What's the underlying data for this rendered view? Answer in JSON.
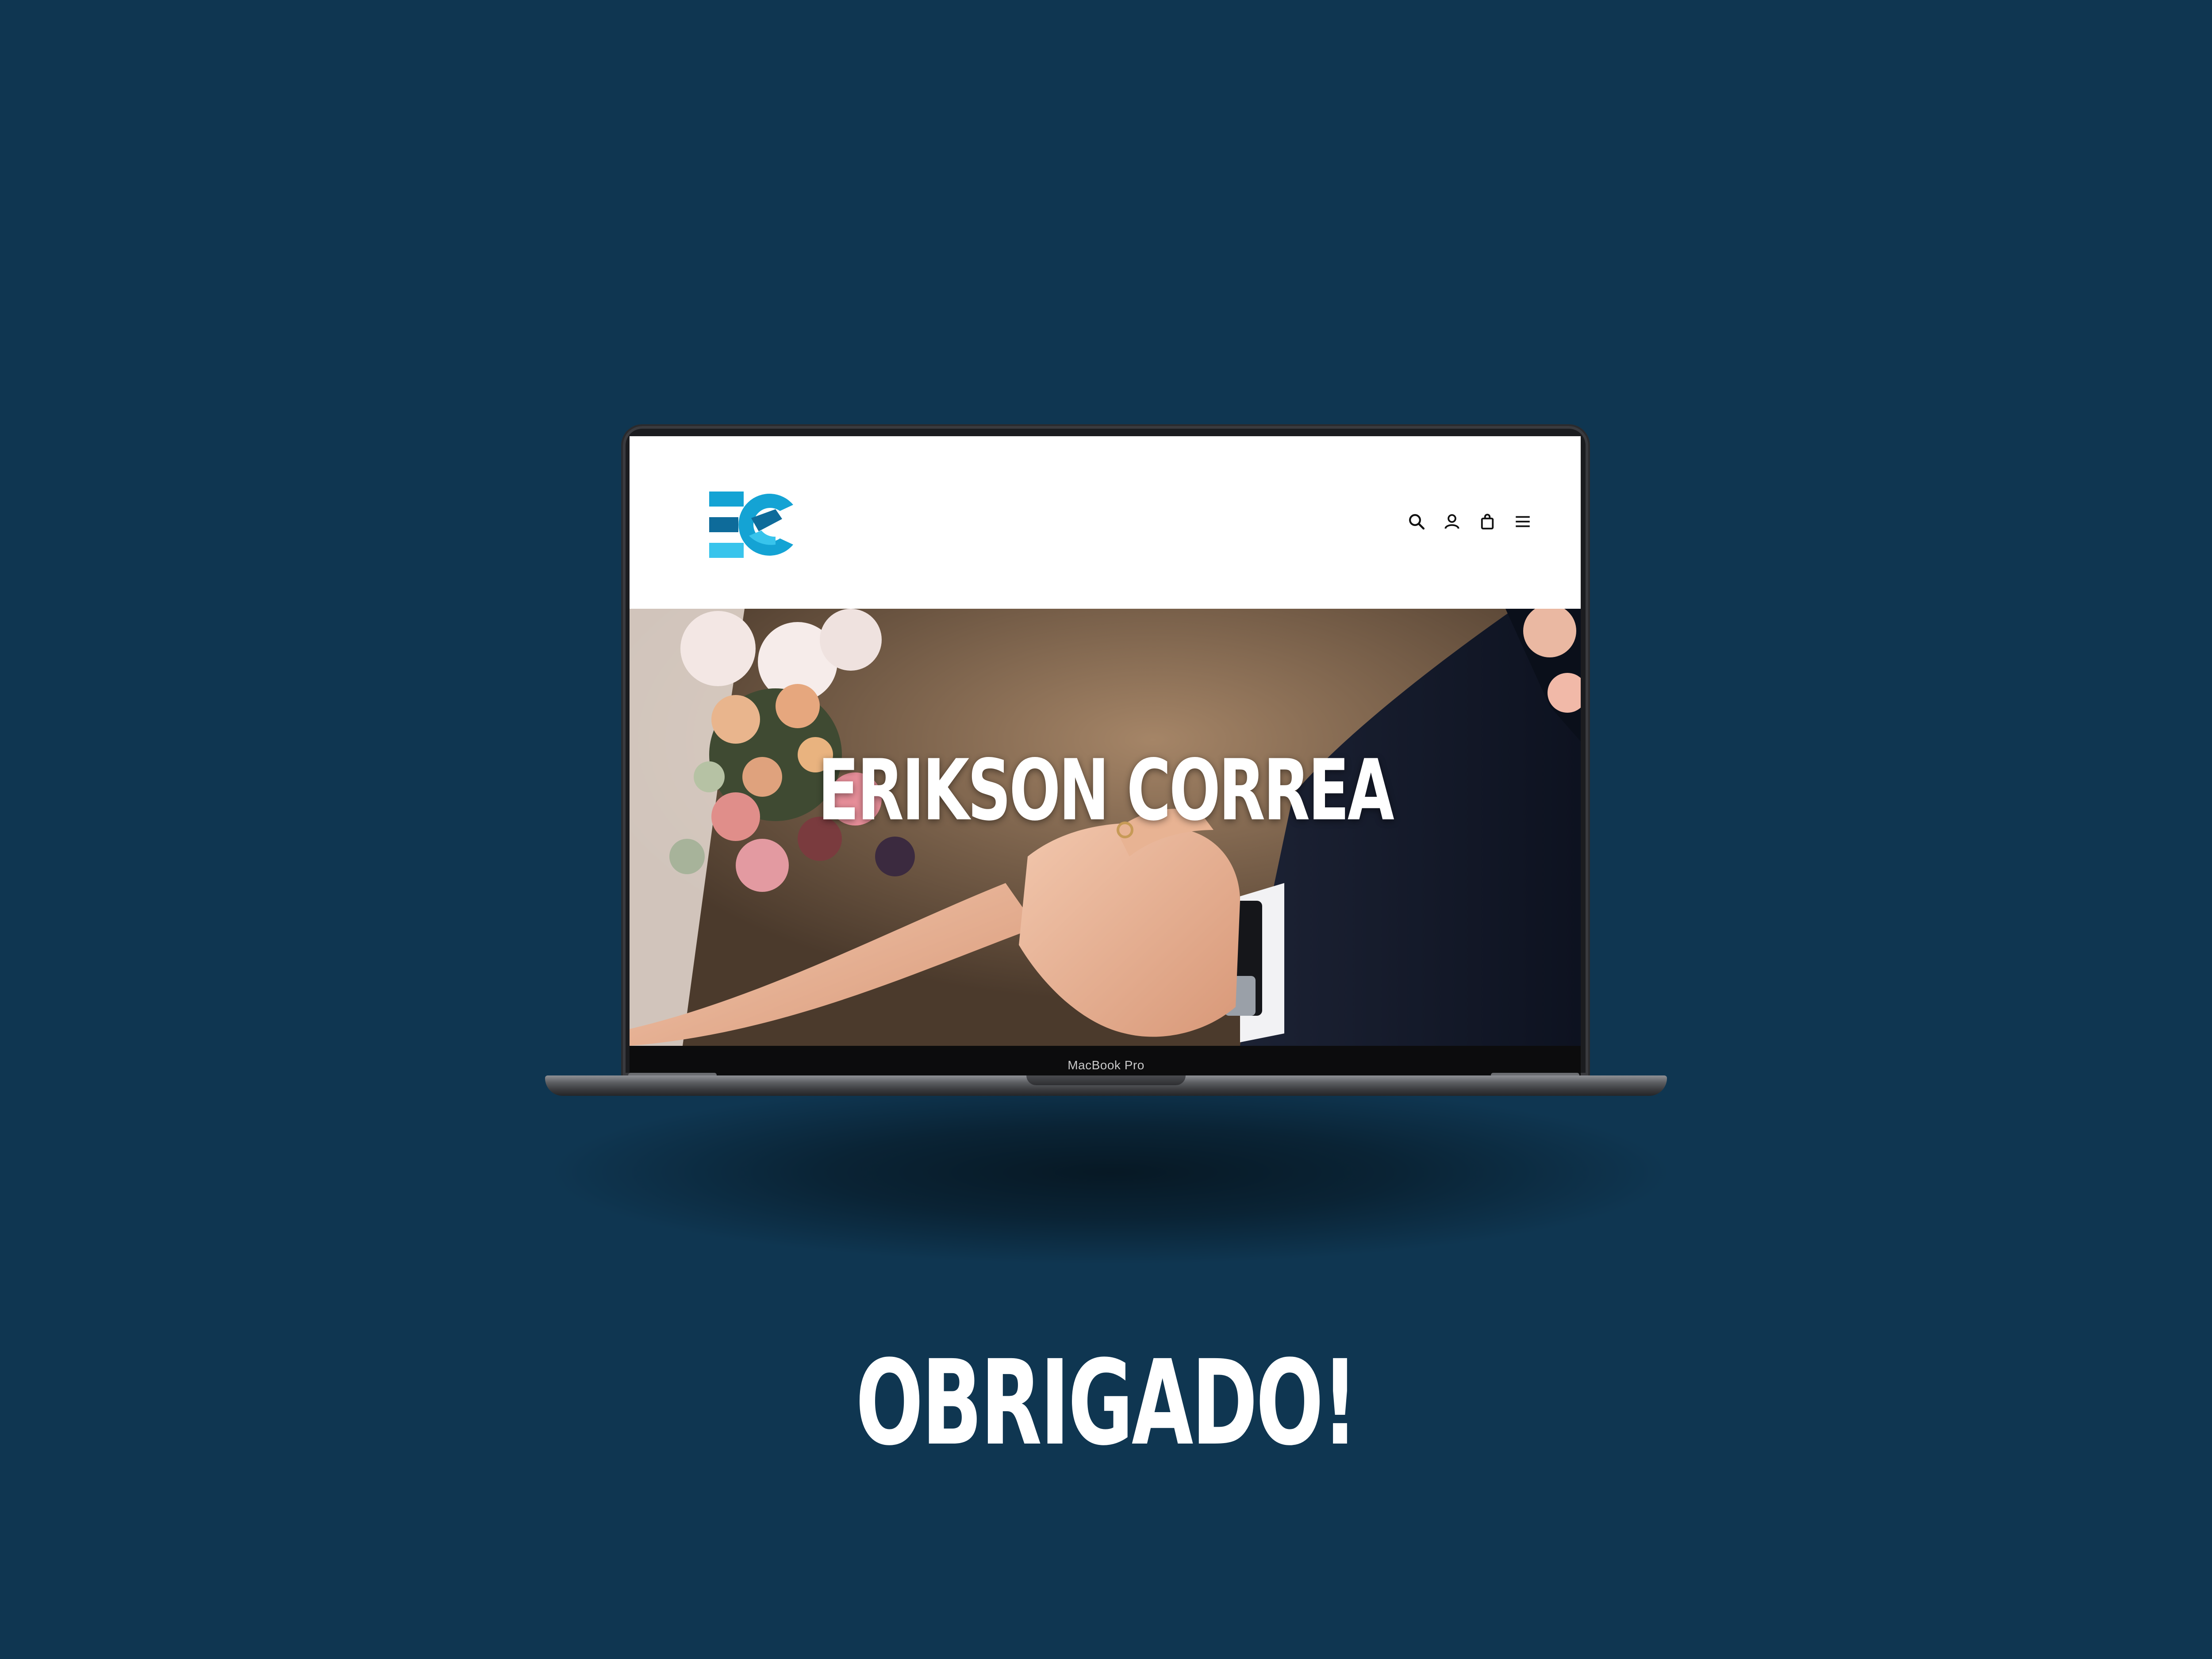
{
  "page": {
    "background_color": "#0f3651",
    "thanks_text": "OBRIGADO!"
  },
  "device": {
    "model_label": "MacBook Pro"
  },
  "site": {
    "logo": {
      "text": "EC",
      "colors": [
        "#14a3d4",
        "#0e6b9a",
        "#38c4ec"
      ]
    },
    "nav_icons": [
      "search-icon",
      "user-icon",
      "bag-icon",
      "menu-icon"
    ],
    "hero": {
      "title": "ERIKSON CORREA"
    }
  }
}
